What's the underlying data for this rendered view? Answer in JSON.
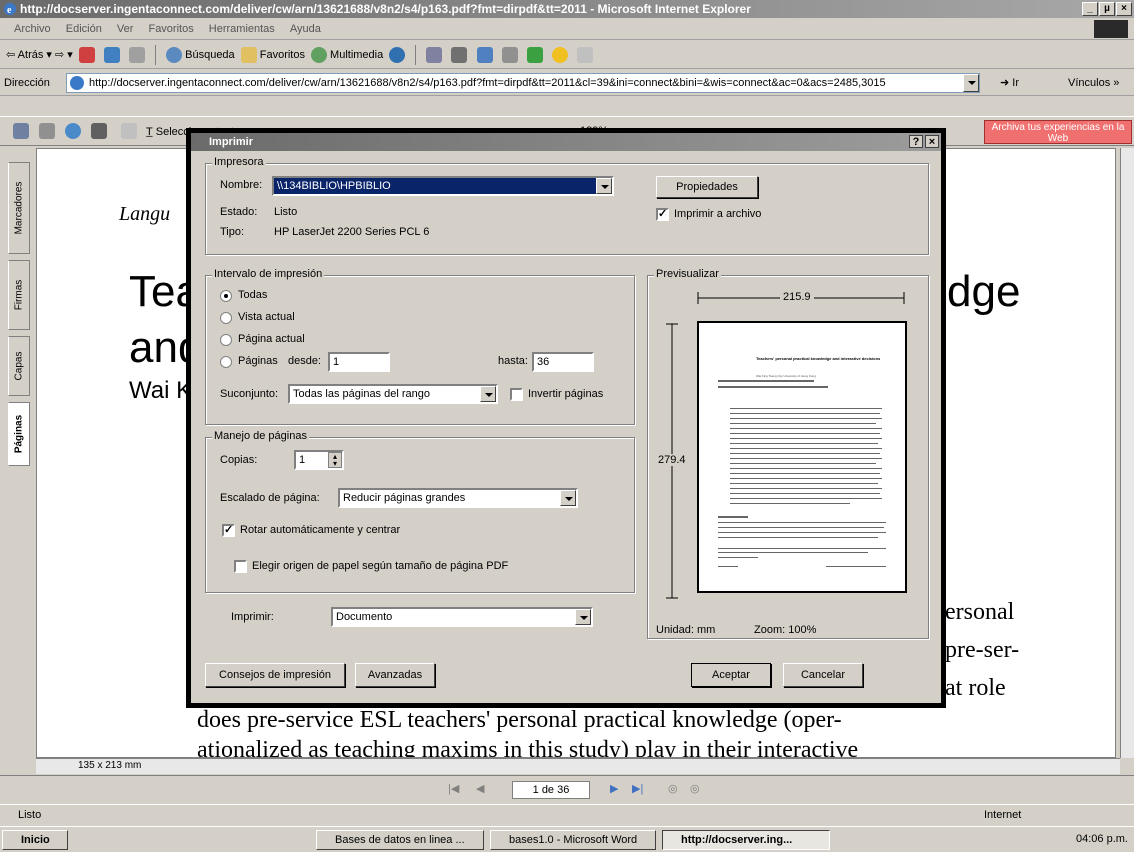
{
  "window": {
    "title": "http://docserver.ingentaconnect.com/deliver/cw/arn/13621688/v8n2/s4/p163.pdf?fmt=dirpdf&tt=2011 - Microsoft Internet Explorer",
    "controls": [
      "_",
      "µ",
      "×"
    ]
  },
  "menu": [
    "Archivo",
    "Edición",
    "Ver",
    "Favoritos",
    "Herramientas",
    "Ayuda"
  ],
  "toolbar": {
    "back": "Atrás",
    "search": "Búsqueda",
    "favorites": "Favoritos",
    "multimedia": "Multimedia"
  },
  "address": {
    "label": "Dirección",
    "url": "http://docserver.ingentaconnect.com/deliver/cw/arn/13621688/v8n2/s4/p163.pdf?fmt=dirpdf&tt=2011&cl=39&ini=connect&bini=&wis=connect&ac=0&acs=2485,3015",
    "go": "Ir",
    "links": "Vínculos"
  },
  "acrobat": {
    "select_text": "Seleccionar texto",
    "zoom": "189%",
    "archiva_button": "Archiva tus experiencias en la Web"
  },
  "side_tabs": [
    "Marcadores",
    "Firmas",
    "Capas",
    "Páginas"
  ],
  "doc": {
    "journal": "Langu",
    "title_line1": "Tea",
    "title_line1_right": "dge",
    "title_line2": "and",
    "author": "Wai K",
    "body_right1": "ersonal",
    "body_right2": "pre-ser-",
    "body_right3": "at role",
    "body_line4": "does pre-service ESL teachers' personal practical knowledge (oper-",
    "body_line5": "ationalized as teaching maxims in this study) play in their interactive"
  },
  "page_size": "135 x 213 mm",
  "page_nav": "1 de 36",
  "status": {
    "left": "Listo",
    "zone": "Internet"
  },
  "taskbar": {
    "start": "Inicio",
    "tasks": [
      "Bases de datos en linea ...",
      "bases1.0 - Microsoft Word",
      "http://docserver.ing..."
    ],
    "clock": "04:06 p.m."
  },
  "dialog": {
    "title": "Imprimir",
    "printer_group": "Impresora",
    "name_label": "Nombre:",
    "name_value": "\\\\134BIBLIO\\HPBIBLIO",
    "status_label": "Estado:",
    "status_value": "Listo",
    "type_label": "Tipo:",
    "type_value": "HP LaserJet 2200 Series PCL 6",
    "properties_button": "Propiedades",
    "print_to_file": "Imprimir a archivo",
    "range_group": "Intervalo de impresión",
    "range_all": "Todas",
    "range_view": "Vista actual",
    "range_current": "Página actual",
    "range_pages": "Páginas",
    "from_label": "desde:",
    "from_value": "1",
    "to_label": "hasta:",
    "to_value": "36",
    "subset_label": "Suconjunto:",
    "subset_value": "Todas las páginas del rango",
    "invert_pages": "Invertir páginas",
    "handling_group": "Manejo de páginas",
    "copies_label": "Copias:",
    "copies_value": "1",
    "scaling_label": "Escalado de página:",
    "scaling_value": "Reducir páginas grandes",
    "auto_rotate": "Rotar automáticamente y centrar",
    "paper_source": "Elegir origen de papel según tamaño de página PDF",
    "print_label": "Imprimir:",
    "print_value": "Documento",
    "preview_group": "Previsualizar",
    "preview_width": "215.9",
    "preview_height": "279.4",
    "unit": "Unidad: mm",
    "zoom": "Zoom: 100%",
    "tips_button": "Consejos de impresión",
    "advanced_button": "Avanzadas",
    "ok_button": "Aceptar",
    "cancel_button": "Cancelar",
    "preview_page": {
      "title": "Teachers' personal practical knowledge and interactive decisions",
      "author": "Wai King Tsang City University of Hong Kong"
    }
  }
}
